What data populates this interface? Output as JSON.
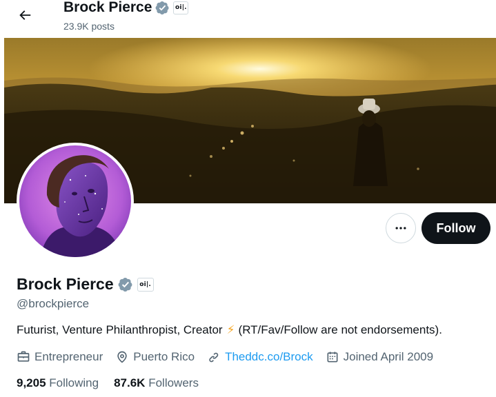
{
  "header": {
    "back_icon": "arrow-left-icon",
    "name": "Brock Pierce",
    "verified_icon": "verified-badge-icon",
    "affiliate_badge": "oi|.",
    "posts": "23.9K posts"
  },
  "actions": {
    "more_icon": "more-horizontal-icon",
    "follow_label": "Follow"
  },
  "profile": {
    "name": "Brock Pierce",
    "affiliate_badge": "oi|.",
    "handle": "@brockpierce",
    "bio_before": "Futurist, Venture Philanthropist, Creator",
    "bio_emoji": "⚡",
    "bio_after": "(RT/Fav/Follow are not endorsements).",
    "profession": "Entrepreneur",
    "location": "Puerto Rico",
    "website": "Theddc.co/Brock",
    "joined": "Joined April 2009"
  },
  "stats": {
    "following_count": "9,205",
    "following_label": "Following",
    "followers_count": "87.6K",
    "followers_label": "Followers"
  },
  "colors": {
    "accent": "#1d9bf0",
    "text": "#0f1419",
    "muted": "#536471",
    "verified": "#829aab",
    "follow_bg": "#0f1419"
  }
}
